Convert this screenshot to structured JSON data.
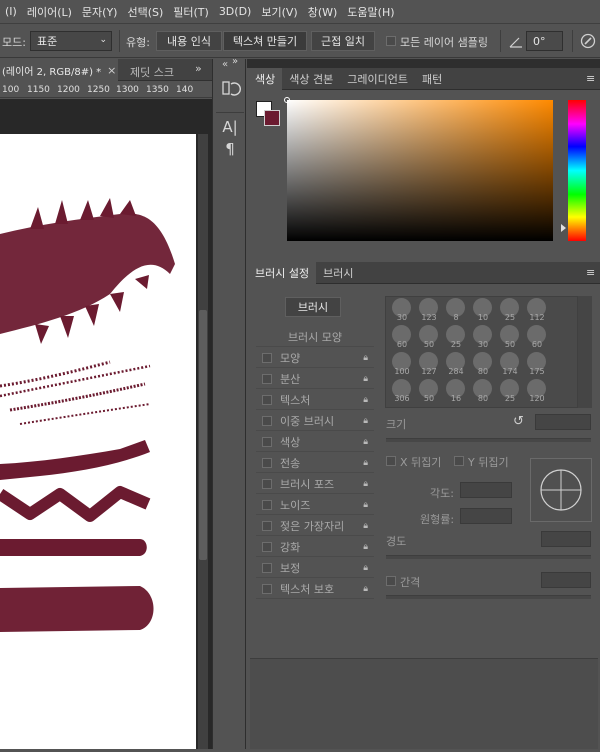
{
  "menu": [
    "(I)",
    "레이어(L)",
    "문자(Y)",
    "선택(S)",
    "필터(T)",
    "3D(D)",
    "보기(V)",
    "창(W)",
    "도움말(H)"
  ],
  "options": {
    "mode_label": "모드:",
    "mode_value": "표준",
    "type_label": "유형:",
    "type_content_aware": "내용 인식",
    "type_create_texture": "텍스쳐 만들기",
    "type_proximity": "근접 일치",
    "sample_all_layers": "모든 레이어 샘플링",
    "angle_value": "0°"
  },
  "doc": {
    "tab_title": "(레이어 2, RGB/8#) *",
    "tab_close": "×",
    "tab2_title": "제딧 스크",
    "ruler": [
      "100",
      "1150",
      "1200",
      "1250",
      "1300",
      "1350",
      "140"
    ]
  },
  "color_panel": {
    "tabs": [
      "색상",
      "색상 견본",
      "그레이디언트",
      "패턴"
    ],
    "accent": "#6b1b30"
  },
  "brush_panel": {
    "tabs": [
      "브러시 설정",
      "브러시"
    ],
    "brushes_button": "브러시",
    "items": [
      {
        "label": "브러시 모양",
        "checkbox": false,
        "lock": false
      },
      {
        "label": "모양",
        "checkbox": true,
        "lock": true
      },
      {
        "label": "분산",
        "checkbox": true,
        "lock": true
      },
      {
        "label": "텍스처",
        "checkbox": true,
        "lock": true
      },
      {
        "label": "이중 브러시",
        "checkbox": true,
        "lock": true
      },
      {
        "label": "색상",
        "checkbox": true,
        "lock": true
      },
      {
        "label": "전송",
        "checkbox": true,
        "lock": true
      },
      {
        "label": "브러시 포즈",
        "checkbox": true,
        "lock": true
      },
      {
        "label": "노이즈",
        "checkbox": true,
        "lock": true
      },
      {
        "label": "젖은 가장자리",
        "checkbox": true,
        "lock": true
      },
      {
        "label": "강화",
        "checkbox": true,
        "lock": true
      },
      {
        "label": "보정",
        "checkbox": true,
        "lock": true
      },
      {
        "label": "텍스처 보호",
        "checkbox": true,
        "lock": true
      }
    ],
    "tip_numbers": [
      "30",
      "123",
      "8",
      "10",
      "25",
      "112",
      "60",
      "50",
      "25",
      "30",
      "50",
      "60",
      "100",
      "127",
      "284",
      "80",
      "174",
      "175",
      "306",
      "50",
      "16",
      "80",
      "25",
      "120"
    ],
    "size_label": "크기",
    "flip_x": "X 뒤집기",
    "flip_y": "Y 뒤집기",
    "angle_label": "각도:",
    "roundness_label": "원형률:",
    "hardness_label": "경도",
    "spacing_label": "간격"
  }
}
